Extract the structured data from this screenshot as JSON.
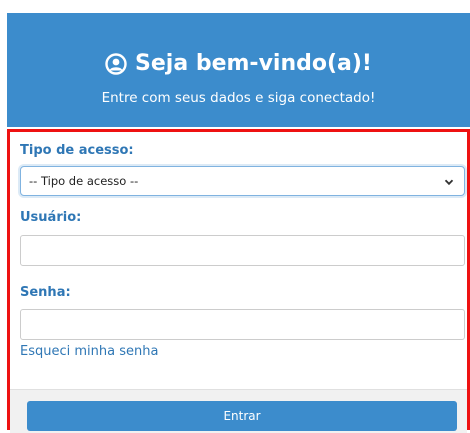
{
  "header": {
    "title": "Seja bem-vindo(a)!",
    "subtitle": "Entre com seus dados e siga conectado!",
    "icon": "user-circle-icon"
  },
  "form": {
    "access_type_label": "Tipo de acesso:",
    "access_type_value": "-- Tipo de acesso --",
    "username_label": "Usuário:",
    "username_value": "",
    "password_label": "Senha:",
    "password_value": "",
    "forgot_password_link": "Esqueci minha senha",
    "submit_label": "Entrar"
  },
  "colors": {
    "primary": "#3c8ccc",
    "label": "#2f77b5",
    "highlight_border": "#ee1111",
    "footer_bg": "#f1f1f1"
  }
}
